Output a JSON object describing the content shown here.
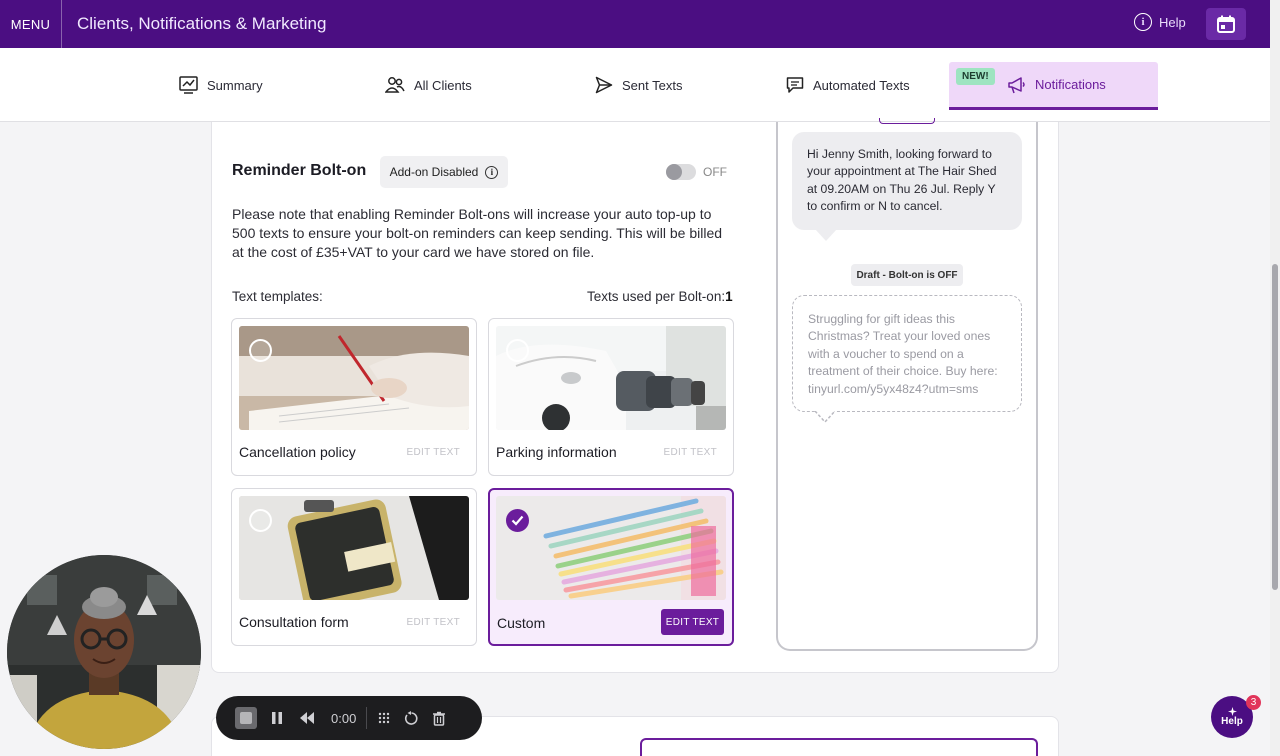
{
  "topbar": {
    "menu_label": "MENU",
    "title": "Clients, Notifications & Marketing",
    "help_label": "Help",
    "calendar_icon": "calendar-icon"
  },
  "nav": {
    "tabs": [
      {
        "label": "Summary",
        "icon": "chart-icon"
      },
      {
        "label": "All Clients",
        "icon": "users-icon"
      },
      {
        "label": "Sent Texts",
        "icon": "send-icon"
      },
      {
        "label": "Automated Texts",
        "icon": "chat-icon"
      },
      {
        "label": "Notifications",
        "icon": "megaphone-icon",
        "active": true
      }
    ],
    "new_badge": "NEW!"
  },
  "reminder": {
    "title": "Reminder Bolt-on",
    "addon_status": "Add-on Disabled",
    "toggle_label": "OFF",
    "toggle_on": false,
    "description": "Please note that enabling Reminder Bolt-ons will increase your auto top-up to 500 texts to ensure your bolt-on reminders can keep sending. This will be billed at the cost of £35+VAT to your card we have stored on file.",
    "templates_label": "Text templates:",
    "texts_used_label": "Texts used per Bolt-on:",
    "texts_used_value": "1"
  },
  "templates": [
    {
      "name": "Cancellation policy",
      "edit_label": "EDIT TEXT",
      "selected": false
    },
    {
      "name": "Parking information",
      "edit_label": "EDIT TEXT",
      "selected": false
    },
    {
      "name": "Consultation form",
      "edit_label": "EDIT TEXT",
      "selected": false
    },
    {
      "name": "Custom",
      "edit_label": "EDIT TEXT",
      "selected": true
    }
  ],
  "preview": {
    "message": "Hi Jenny Smith, looking forward to your appointment at The Hair Shed at 09.20AM on Thu 26 Jul. Reply Y to confirm or N to cancel.",
    "draft_label": "Draft - Bolt-on is OFF",
    "draft_message": "Struggling for gift ideas this Christmas? Treat your loved ones with a voucher to spend on a treatment of their choice. Buy here: tinyurl.com/y5yx48z4?utm=sms"
  },
  "recorder": {
    "time": "0:00"
  },
  "help_fab": {
    "label": "Help",
    "badge_count": "3"
  },
  "colors": {
    "brand_purple": "#4b0e82",
    "accent_purple": "#6b1d9c",
    "active_tab_bg": "#efd8f9",
    "new_badge_bg": "#9ee4c1"
  }
}
